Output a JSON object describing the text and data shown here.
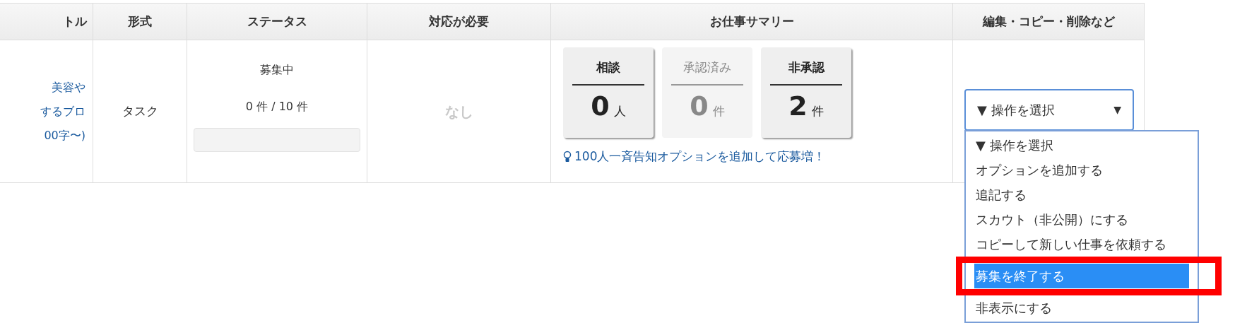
{
  "table": {
    "columns": [
      "トル",
      "形式",
      "ステータス",
      "対応が必要",
      "お仕事サマリー",
      "編集・コピー・削除など"
    ],
    "row": {
      "title_lines": [
        "美容や",
        "するブロ",
        "00字〜)"
      ],
      "format": "タスク",
      "status": {
        "label": "募集中",
        "count": "0 件 / 10 件",
        "level": 0
      },
      "action_needed": "なし",
      "summary": {
        "cards": [
          {
            "label": "相談",
            "value": "0",
            "unit": "人",
            "disabled": false
          },
          {
            "label": "承認済み",
            "value": "0",
            "unit": "件",
            "disabled": true
          },
          {
            "label": "非承認",
            "value": "2",
            "unit": "件",
            "disabled": false
          }
        ],
        "hint": "100人一斉告知オプションを追加して応募増！"
      },
      "actions": {
        "select": {
          "value": "▼ 操作を選択",
          "caret": "▼",
          "expanded": true
        },
        "options": [
          {
            "label": "▼ 操作を選択",
            "selected": false,
            "marked": false
          },
          {
            "label": "オプションを追加する",
            "selected": false,
            "marked": false
          },
          {
            "label": "追記する",
            "selected": false,
            "marked": false
          },
          {
            "label": "スカウト（非公開）にする",
            "selected": false,
            "marked": false
          },
          {
            "label": "コピーして新しい仕事を依頼する",
            "selected": false,
            "marked": false
          },
          {
            "label": "募集を終了する",
            "selected": true,
            "marked": true
          },
          {
            "label": "非表示にする",
            "selected": false,
            "marked": false
          }
        ]
      }
    }
  }
}
